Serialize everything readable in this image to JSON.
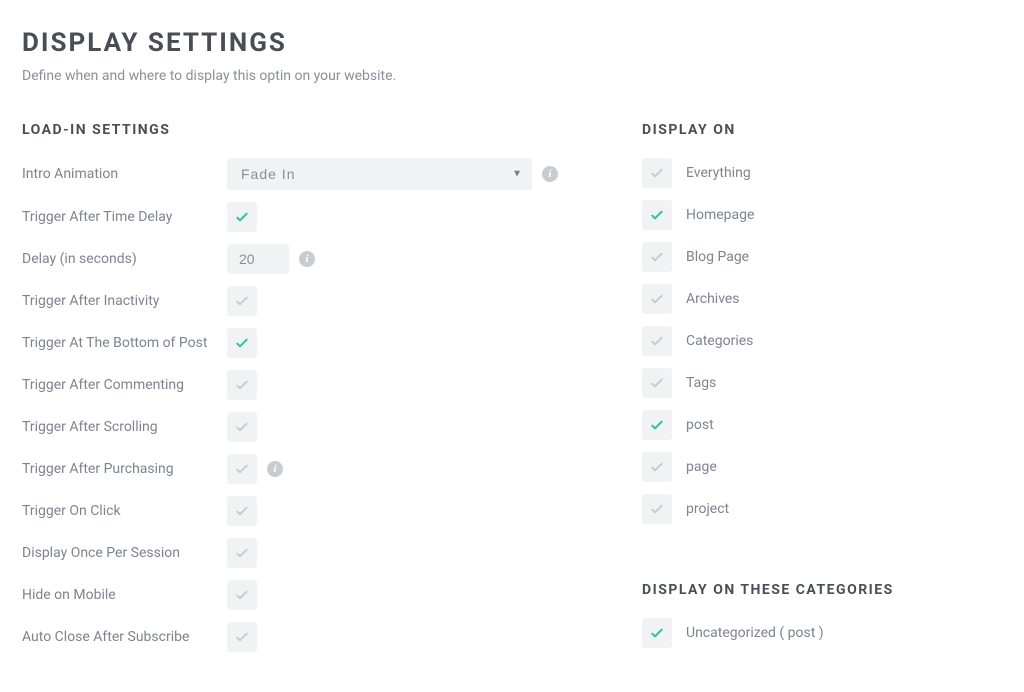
{
  "header": {
    "title": "DISPLAY SETTINGS",
    "subtitle": "Define when and where to display this optin on your website."
  },
  "loadIn": {
    "heading": "LOAD-IN SETTINGS",
    "introAnimation": {
      "label": "Intro Animation",
      "value": "Fade In",
      "options": [
        "Fade In"
      ]
    },
    "delay": {
      "label": "Delay (in seconds)",
      "value": "20"
    },
    "toggles": [
      {
        "key": "trigger-time-delay",
        "label": "Trigger After Time Delay",
        "checked": true
      },
      {
        "key": "trigger-inactivity",
        "label": "Trigger After Inactivity",
        "checked": false
      },
      {
        "key": "trigger-bottom-post",
        "label": "Trigger At The Bottom of Post",
        "checked": true
      },
      {
        "key": "trigger-commenting",
        "label": "Trigger After Commenting",
        "checked": false
      },
      {
        "key": "trigger-scrolling",
        "label": "Trigger After Scrolling",
        "checked": false
      },
      {
        "key": "trigger-purchasing",
        "label": "Trigger After Purchasing",
        "checked": false,
        "info": true
      },
      {
        "key": "trigger-on-click",
        "label": "Trigger On Click",
        "checked": false
      },
      {
        "key": "display-once-session",
        "label": "Display Once Per Session",
        "checked": false
      },
      {
        "key": "hide-on-mobile",
        "label": "Hide on Mobile",
        "checked": false
      },
      {
        "key": "auto-close-subscribe",
        "label": "Auto Close After Subscribe",
        "checked": false
      }
    ]
  },
  "displayOn": {
    "heading": "DISPLAY ON",
    "items": [
      {
        "key": "everything",
        "label": "Everything",
        "checked": false
      },
      {
        "key": "homepage",
        "label": "Homepage",
        "checked": true
      },
      {
        "key": "blog-page",
        "label": "Blog Page",
        "checked": false
      },
      {
        "key": "archives",
        "label": "Archives",
        "checked": false
      },
      {
        "key": "categories",
        "label": "Categories",
        "checked": false
      },
      {
        "key": "tags",
        "label": "Tags",
        "checked": false
      },
      {
        "key": "post",
        "label": "post",
        "checked": true
      },
      {
        "key": "page",
        "label": "page",
        "checked": false
      },
      {
        "key": "project",
        "label": "project",
        "checked": false
      }
    ]
  },
  "displayCategories": {
    "heading": "DISPLAY ON THESE CATEGORIES",
    "items": [
      {
        "key": "uncategorized-post",
        "label": "Uncategorized ( post )",
        "checked": true
      }
    ]
  }
}
